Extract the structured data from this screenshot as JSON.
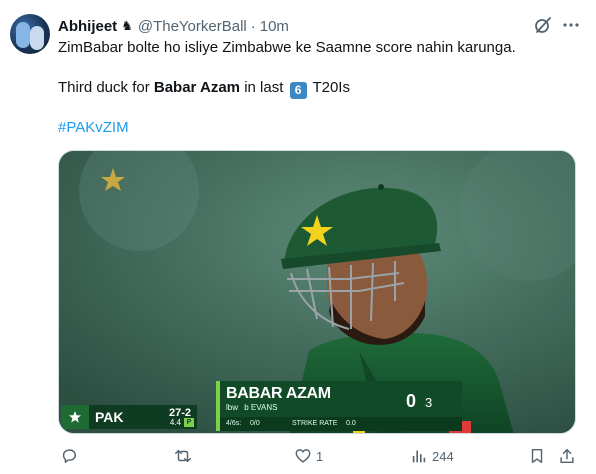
{
  "tweet": {
    "author_name": "Abhijeet",
    "verified_glyph": "♞",
    "handle": "@TheYorkerBall",
    "separator": "·",
    "time": "10m",
    "line1": "ZimBabar bolte ho isliye Zimbabwe ke Saamne score nahin karunga.",
    "line2_prefix": "Third duck for",
    "line2_bold": "Babar Azam",
    "line2_mid": "in last",
    "line2_keycap": "6",
    "line2_suffix": "T20Is",
    "hashtag": "#PAKvZIM"
  },
  "icons": {
    "grok": "grok-icon",
    "more": "more-icon",
    "reply": "reply-icon",
    "retweet": "retweet-icon",
    "like": "like-icon",
    "views": "views-icon",
    "bookmark": "bookmark-icon",
    "share": "share-icon"
  },
  "scoreboard": {
    "team": "PAK",
    "score": "27-2",
    "overs": "4.4",
    "phase": "P",
    "batter": "BABAR AZAM",
    "dismissal_type": "lbw",
    "bowler": "b EVANS",
    "runs": "0",
    "balls": "3",
    "fours_sixes_label": "4/6s:",
    "fours_sixes": "0/0",
    "strike_rate_label": "STRIKE RATE",
    "strike_rate": "0.0"
  },
  "actions": {
    "replies": "",
    "retweets": "",
    "likes": "1",
    "views": "244"
  },
  "colors": {
    "link": "#1d9bf0",
    "muted": "#536471",
    "pak_green": "#114a26",
    "accent_green": "#7bd24a"
  }
}
